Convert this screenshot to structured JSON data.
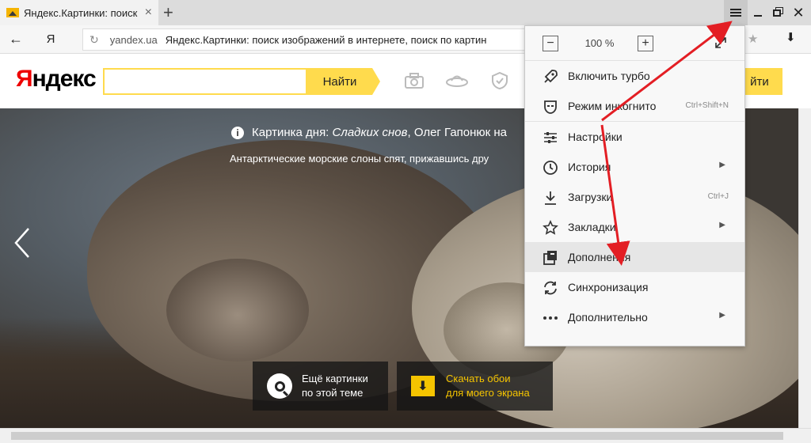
{
  "browser": {
    "tab": {
      "title": "Яндекс.Картинки: поиск",
      "close": "×"
    },
    "new_tab": "+",
    "window": {
      "menu_icon": "hamburger-icon",
      "close": "✕"
    },
    "nav": {
      "back": "←",
      "y_button": "Я",
      "reload": "↻"
    },
    "url": {
      "domain": "yandex.ua",
      "title": "Яндекс.Картинки: поиск изображений в интернете, поиск по картин"
    },
    "star": "★",
    "downloads": "⬇"
  },
  "page": {
    "logo": {
      "first": "Я",
      "rest": "ндекс"
    },
    "search": {
      "value": "",
      "button": "Найти",
      "right_button": "йти"
    },
    "caption": {
      "label": "Картинка дня:",
      "italic": "Сладких снов",
      "rest": ", Олег Гапонюк на",
      "sub": "Антарктические морские слоны спят, прижавшись дру"
    },
    "more_button": {
      "line1": "Ещё картинки",
      "line2": "по этой теме"
    },
    "wallpaper_button": {
      "line1": "Скачать обои",
      "line2": "для моего экрана"
    }
  },
  "menu": {
    "zoom": {
      "minus": "−",
      "value": "100 %",
      "plus": "+"
    },
    "groups": [
      [
        {
          "label": "Включить турбо",
          "icon": "rocket-icon"
        },
        {
          "label": "Режим инкогнито",
          "shortcut": "Ctrl+Shift+N",
          "icon": "incognito-mask-icon"
        }
      ],
      [
        {
          "label": "Настройки",
          "icon": "settings-sliders-icon"
        },
        {
          "label": "История",
          "icon": "clock-icon",
          "submenu": true
        },
        {
          "label": "Загрузки",
          "shortcut": "Ctrl+J",
          "icon": "download-icon"
        },
        {
          "label": "Закладки",
          "icon": "star-icon",
          "submenu": true
        },
        {
          "label": "Дополнения",
          "icon": "addons-icon",
          "highlighted": true
        },
        {
          "label": "Синхронизация",
          "icon": "sync-icon"
        },
        {
          "label": "Дополнительно",
          "icon": "more-dots-icon",
          "submenu": true
        }
      ]
    ]
  },
  "colors": {
    "yandex_yellow": "#ffdb4d",
    "logo_red": "#e00000",
    "annotation_red": "#e31e24"
  }
}
